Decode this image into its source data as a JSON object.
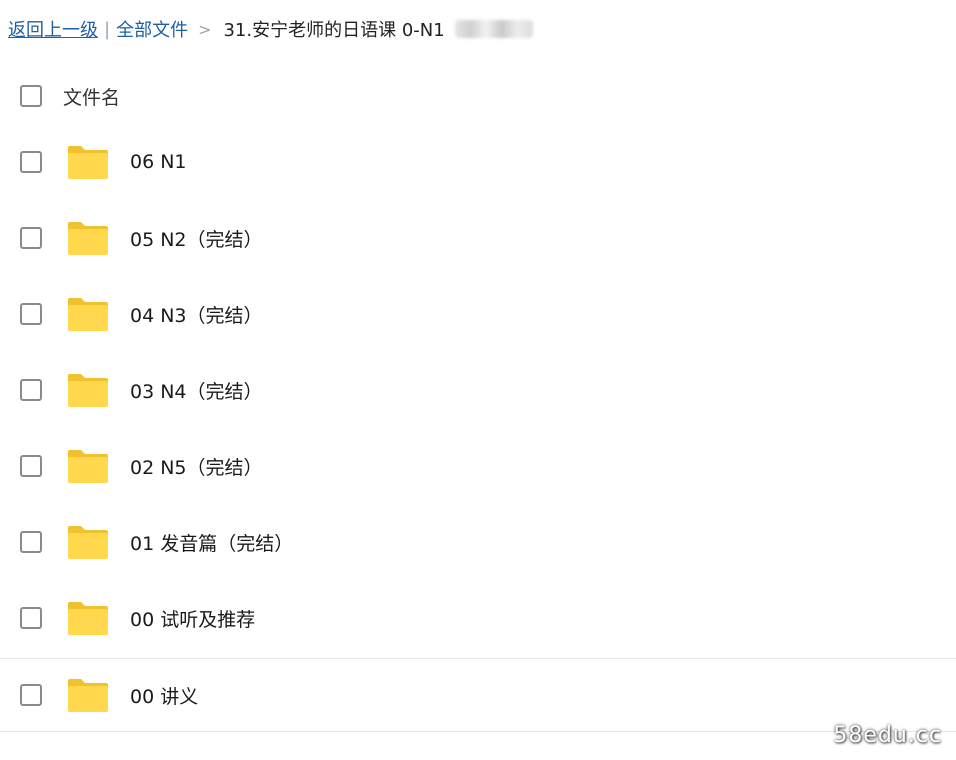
{
  "breadcrumb": {
    "back_label": "返回上一级",
    "separator": "|",
    "root_label": "全部文件",
    "arrow": ">",
    "current_label": "31.安宁老师的日语课 0-N1"
  },
  "list_header": {
    "name_column": "文件名"
  },
  "folders": [
    {
      "name": "06 N1"
    },
    {
      "name": "05 N2（完结）"
    },
    {
      "name": "04 N3（完结）"
    },
    {
      "name": "03 N4（完结）"
    },
    {
      "name": "02 N5（完结）"
    },
    {
      "name": "01 发音篇（完结）"
    },
    {
      "name": "00 试听及推荐"
    },
    {
      "name": "00 讲义"
    }
  ],
  "watermark": "58edu.cc",
  "colors": {
    "link": "#1e5fa8",
    "folder_body": "#ffd84d",
    "folder_tab": "#f2c12e"
  }
}
